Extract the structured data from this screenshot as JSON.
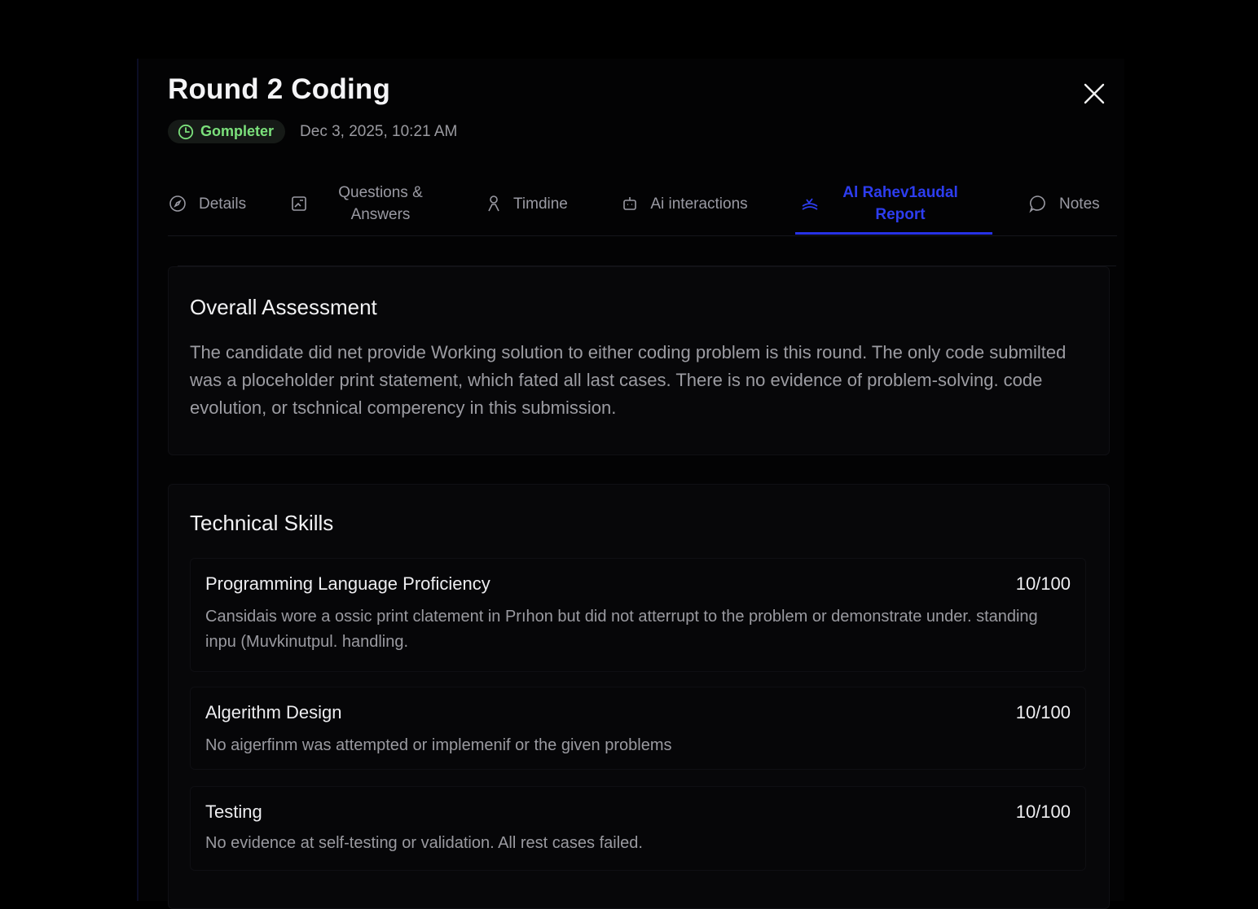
{
  "header": {
    "title": "Round 2 Coding",
    "status": "Gompleter",
    "date": "Dec 3, 2025, 10:21 AM"
  },
  "tabs": [
    {
      "label": "Details",
      "icon": "compass-icon"
    },
    {
      "label": "Questions & Answers",
      "icon": "image-edit-icon"
    },
    {
      "label": "Timdine",
      "icon": "person-icon"
    },
    {
      "label": "Ai interactions",
      "icon": "robot-icon"
    },
    {
      "label": "Al Rahev1audal Report",
      "icon": "report-icon",
      "active": true
    },
    {
      "label": "Notes",
      "icon": "chat-bubble-icon"
    }
  ],
  "assessment": {
    "heading": "Overall Assessment",
    "text": "The candidate did net provide Working solution to either coding problem is this round. The only code submilted was a ploceholder print statement, which fated all last cases. There is no evidence of problem-solving. code evolution, or tschnical comperency in this submission."
  },
  "technical": {
    "heading": "Technical Skills",
    "skills": [
      {
        "name": "Programming Language Proficiency",
        "score": "10/100",
        "description": "Cansidais  wore a ossic print clatement in Prıhon but did not atterrupt to the problem or demonstrate under. standing inpu (Muvkinutpul. handling."
      },
      {
        "name": "Algerithm Design",
        "score": "10/100",
        "description": "No aigerfinm was attempted or implemenif or the given problems"
      },
      {
        "name": "Testing",
        "score": "10/100",
        "description": "No evidence at self-testing or validation. All rest cases failed."
      }
    ]
  },
  "colors": {
    "background": "#000000",
    "accent": "#2732e6",
    "status_green": "#7be07b"
  }
}
